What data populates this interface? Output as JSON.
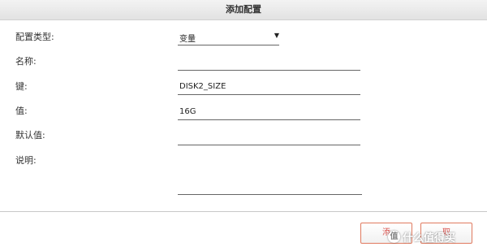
{
  "dialog": {
    "title": "添加配置"
  },
  "form": {
    "config_type_label": "配置类型:",
    "config_type_value": "变量",
    "name_label": "名称:",
    "name_value": "",
    "key_label": "键:",
    "key_value": "DISK2_SIZE",
    "value_label": "值:",
    "value_value": "16G",
    "default_label": "默认值:",
    "default_value": "",
    "desc_label": "说明:",
    "desc_value": ""
  },
  "footer": {
    "add_label": "添",
    "cancel_label": "取"
  },
  "watermark": {
    "text": "值 什么值得买"
  },
  "icons": {
    "dropdown": "caret-down-icon",
    "watermark": "smzdm-logo-icon"
  },
  "colors": {
    "button_border": "#e07a5f",
    "button_text": "#d9534f"
  }
}
